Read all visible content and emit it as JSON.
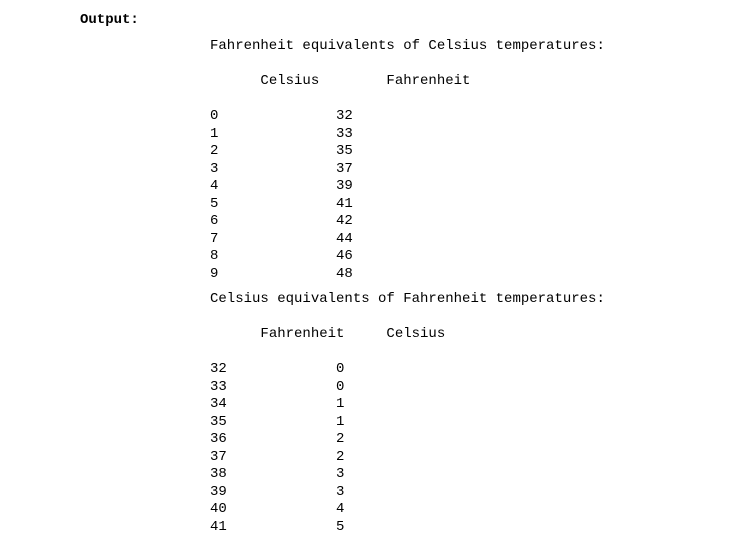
{
  "heading": "Output:",
  "block1": {
    "title": "Fahrenheit equivalents of Celsius temperatures:",
    "header": {
      "col1": "Celsius",
      "col2": "Fahrenheit"
    },
    "rows": [
      {
        "col1": "0",
        "col2": "32"
      },
      {
        "col1": "1",
        "col2": "33"
      },
      {
        "col1": "2",
        "col2": "35"
      },
      {
        "col1": "3",
        "col2": "37"
      },
      {
        "col1": "4",
        "col2": "39"
      },
      {
        "col1": "5",
        "col2": "41"
      },
      {
        "col1": "6",
        "col2": "42"
      },
      {
        "col1": "7",
        "col2": "44"
      },
      {
        "col1": "8",
        "col2": "46"
      },
      {
        "col1": "9",
        "col2": "48"
      }
    ]
  },
  "block2": {
    "title": "Celsius equivalents of Fahrenheit temperatures:",
    "header": {
      "col1": "Fahrenheit",
      "col2": "Celsius"
    },
    "rows": [
      {
        "col1": "32",
        "col2": "0"
      },
      {
        "col1": "33",
        "col2": "0"
      },
      {
        "col1": "34",
        "col2": "1"
      },
      {
        "col1": "35",
        "col2": "1"
      },
      {
        "col1": "36",
        "col2": "2"
      },
      {
        "col1": "37",
        "col2": "2"
      },
      {
        "col1": "38",
        "col2": "3"
      },
      {
        "col1": "39",
        "col2": "3"
      },
      {
        "col1": "40",
        "col2": "4"
      },
      {
        "col1": "41",
        "col2": "5"
      }
    ]
  }
}
